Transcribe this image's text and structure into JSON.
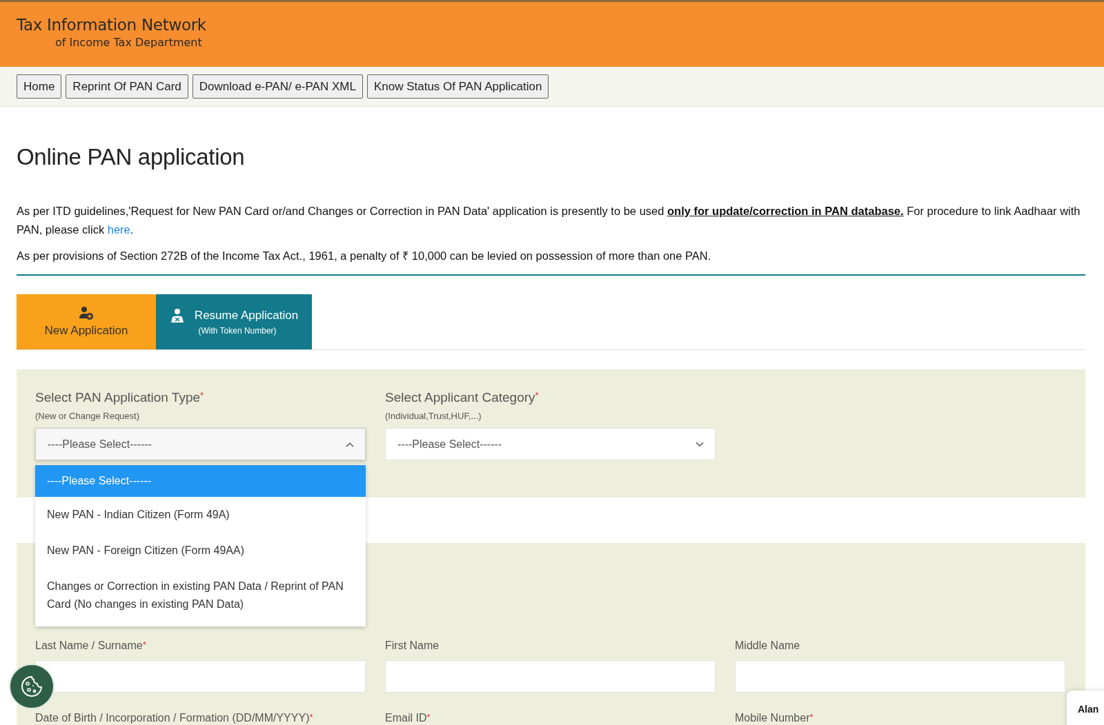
{
  "header": {
    "title": "Tax Information Network",
    "subtitle": "of Income Tax Department"
  },
  "nav": [
    {
      "label": "Home"
    },
    {
      "label": "Reprint Of PAN Card"
    },
    {
      "label": "Download e-PAN/ e-PAN XML"
    },
    {
      "label": "Know Status Of PAN Application"
    }
  ],
  "page_title": "Online PAN application",
  "notice": {
    "text": "As per ITD guidelines,'Request for New PAN Card or/and Changes or Correction in PAN Data' application is presently to be used **only for update/correction in PAN database.** For procedure to link Aadhaar with PAN, please click ",
    "link": "here",
    "end": "."
  },
  "penalty": "As per provisions of Section 272B of the Income Tax Act., 1961, a penalty of ₹ 10,000 can be levied on possession of more than one PAN.",
  "tabs": [
    {
      "kind": "new",
      "label": "New Application",
      "selected": true
    },
    {
      "kind": "resume",
      "label": "Resume Application",
      "note": "(With Token Number)",
      "selected": false
    }
  ],
  "selects": [
    {
      "label": "Select PAN Application Type",
      "mark": "*",
      "hint": "(New or Change Request)",
      "value": "----Please Select------",
      "expanded": true,
      "options": [
        {
          "label": "----Please Select------",
          "selected": true
        },
        {
          "label": "New PAN - Indian Citizen (Form 49A)",
          "selected": false
        },
        {
          "label": "New PAN - Foreign Citizen (Form 49AA)",
          "selected": false
        },
        {
          "label": "Changes or Correction in existing PAN Data / Reprint of PAN Card (No changes in existing PAN Data)",
          "selected": false
        }
      ]
    },
    {
      "label": "Select Applicant Category",
      "mark": "*",
      "hint": "(Individual,Trust,HUF,...)",
      "value": "----Please Select------",
      "expanded": false
    }
  ],
  "name_fields": [
    {
      "label": "Last Name / Surname",
      "mark": "*"
    },
    {
      "label": "First Name"
    },
    {
      "label": "Middle Name"
    }
  ],
  "next_fields": [
    {
      "label": "Date of Birth / Incorporation / Formation (DD/MM/YYYY)",
      "mark": "*"
    },
    {
      "label": "Email ID",
      "mark": "*"
    },
    {
      "label": "Mobile Number",
      "mark": "*"
    }
  ],
  "chat_widget": {
    "name": "Alan"
  }
}
